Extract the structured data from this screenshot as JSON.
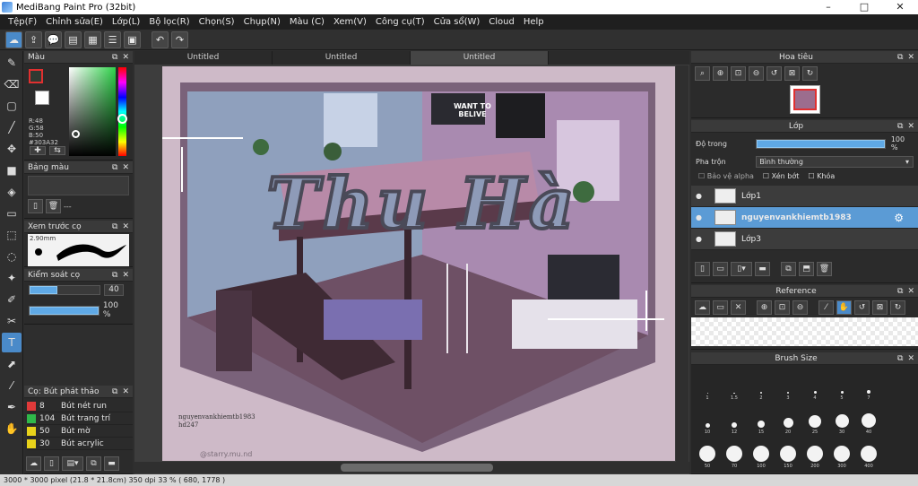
{
  "window": {
    "title": "MediBang Paint Pro (32bit)",
    "controls": [
      "–",
      "□",
      "✕"
    ]
  },
  "menu": [
    "Tệp(F)",
    "Chỉnh sửa(E)",
    "Lớp(L)",
    "Bộ lọc(R)",
    "Chọn(S)",
    "Chụp(N)",
    "Màu (C)",
    "Xem(V)",
    "Công cụ(T)",
    "Cửa sổ(W)",
    "Cloud",
    "Help"
  ],
  "tabs": [
    "Untitled",
    "Untitled",
    "Untitled"
  ],
  "color_panel": {
    "title": "Màu",
    "r_label": "R:48",
    "g_label": "G:58",
    "b_label": "B:50",
    "hex": "#303A32",
    "primary_color": "#303a32",
    "secondary_color": "#ffffff"
  },
  "palette_panel": {
    "title": "Bảng màu",
    "dash": "---"
  },
  "brush_preview_panel": {
    "title": "Xem trước cọ",
    "size": "2.90mm"
  },
  "brush_control_panel": {
    "title": "Kiểm soát cọ",
    "size_value": "40",
    "opacity_value": "100 %",
    "size_fill": 0.4,
    "opacity_fill": 1.0
  },
  "brush_list_panel": {
    "title": "Cọ: Bút phát thảo",
    "items": [
      {
        "color": "#e03a3a",
        "size": "8",
        "name": "Bút nét run"
      },
      {
        "color": "#2fb84a",
        "size": "104",
        "name": "Bút trang trí"
      },
      {
        "color": "#e8d21a",
        "size": "50",
        "name": "Bút mờ"
      },
      {
        "color": "#e8d21a",
        "size": "30",
        "name": "Bút acrylic"
      }
    ]
  },
  "artwork": {
    "title_text": "Thu Hà",
    "signature_line1": "nguyenvankhiemtb1983",
    "signature_line2": "hd247",
    "watermark": "@starry.mu.nd",
    "poster_text": "WANT TO BELIVE"
  },
  "navigator_panel": {
    "title": "Hoa tiêu"
  },
  "layer_panel": {
    "title": "Lớp",
    "opacity_label": "Độ trong",
    "opacity_value": "100 %",
    "opacity_fill": 1.0,
    "blend_label": "Pha trộn",
    "blend_value": "Bình thường",
    "protect_alpha": "Bảo vệ alpha",
    "clipping": "Xén bớt",
    "lock": "Khóa",
    "layers": [
      {
        "name": "Lớp1",
        "selected": false
      },
      {
        "name": "nguyenvankhiemtb1983",
        "selected": true
      },
      {
        "name": "Lớp3",
        "selected": false
      }
    ]
  },
  "reference_panel": {
    "title": "Reference"
  },
  "brush_size_panel": {
    "title": "Brush Size",
    "sizes": [
      "1",
      "1.5",
      "2",
      "3",
      "4",
      "5",
      "7",
      "10",
      "12",
      "15",
      "20",
      "25",
      "30",
      "40",
      "50",
      "70",
      "100",
      "150",
      "200",
      "300",
      "400"
    ]
  },
  "status": "3000 * 3000 pixel  (21.8 * 21.8cm)  350 dpi  33 %  ( 680, 1778 )"
}
